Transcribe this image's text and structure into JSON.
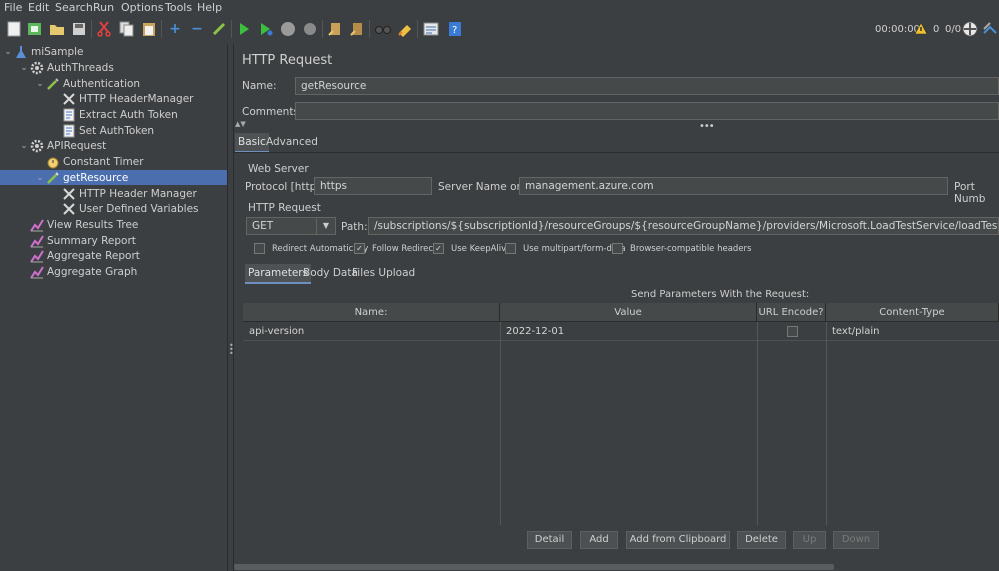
{
  "menu": [
    "File",
    "Edit",
    "Search",
    "Run",
    "Options",
    "Tools",
    "Help"
  ],
  "toolbar": {
    "icons": [
      "new-icon",
      "templates-icon",
      "open-icon",
      "save-icon",
      "cut-icon",
      "copy-icon",
      "paste-icon",
      "expand-icon",
      "collapse-icon",
      "toggle-icon",
      "start-icon",
      "start-no-pause-icon",
      "stop-icon",
      "shutdown-icon",
      "clear-icon",
      "clear-all-icon",
      "search-icon",
      "reset-search-icon",
      "function-helper-icon",
      "help-icon"
    ],
    "timer": "00:00:00",
    "warnings": "0",
    "threads": "0/0"
  },
  "tree": {
    "nodes": [
      {
        "label": "miSample",
        "icon": "test-plan-icon",
        "level": 0,
        "expanded": true
      },
      {
        "label": "AuthThreads",
        "icon": "thread-group-icon",
        "level": 1,
        "expanded": true
      },
      {
        "label": "Authentication",
        "icon": "sampler-icon",
        "level": 2,
        "expanded": true
      },
      {
        "label": "HTTP HeaderManager",
        "icon": "config-icon",
        "level": 3
      },
      {
        "label": "Extract Auth Token",
        "icon": "script-icon",
        "level": 3
      },
      {
        "label": "Set AuthToken",
        "icon": "script-icon",
        "level": 3
      },
      {
        "label": "APIRequest",
        "icon": "thread-group-icon",
        "level": 1,
        "expanded": true
      },
      {
        "label": "Constant Timer",
        "icon": "timer-icon",
        "level": 2
      },
      {
        "label": "getResource",
        "icon": "sampler-icon",
        "level": 2,
        "expanded": true,
        "selected": true
      },
      {
        "label": "HTTP Header Manager",
        "icon": "config-icon",
        "level": 3
      },
      {
        "label": "User Defined Variables",
        "icon": "config-icon",
        "level": 3
      },
      {
        "label": "View Results Tree",
        "icon": "listener-icon",
        "level": 1
      },
      {
        "label": "Summary Report",
        "icon": "listener-icon",
        "level": 1
      },
      {
        "label": "Aggregate Report",
        "icon": "listener-icon",
        "level": 1
      },
      {
        "label": "Aggregate Graph",
        "icon": "listener-icon",
        "level": 1
      }
    ]
  },
  "panel": {
    "title": "HTTP Request",
    "name_label": "Name:",
    "name_value": "getResource",
    "comments_label": "Comments:",
    "comments_value": "",
    "tabs": [
      "Basic",
      "Advanced"
    ],
    "web_server_label": "Web Server",
    "protocol_label": "Protocol [http]:",
    "protocol_value": "https",
    "server_label": "Server Name or IP:",
    "server_value": "management.azure.com",
    "port_label": "Port Numb",
    "http_request_label": "HTTP Request",
    "method": "GET",
    "path_label": "Path:",
    "path_value": "/subscriptions/${subscriptionId}/resourceGroups/${resourceGroupName}/providers/Microsoft.LoadTestService/loadTests/${loadTestName}",
    "checkboxes": [
      {
        "label": "Redirect Automatically",
        "checked": false
      },
      {
        "label": "Follow Redirects",
        "checked": true
      },
      {
        "label": "Use KeepAlive",
        "checked": true
      },
      {
        "label": "Use multipart/form-data",
        "checked": false
      },
      {
        "label": "Browser-compatible headers",
        "checked": false
      }
    ],
    "subtabs": [
      "Parameters",
      "Body Data",
      "Files Upload"
    ],
    "send_title": "Send Parameters With the Request:",
    "columns": [
      "Name:",
      "Value",
      "URL Encode?",
      "Content-Type"
    ],
    "rows": [
      {
        "name": "api-version",
        "value": "2022-12-01",
        "encode": false,
        "content_type": "text/plain"
      }
    ],
    "buttons": [
      {
        "label": "Detail",
        "enabled": true
      },
      {
        "label": "Add",
        "enabled": true
      },
      {
        "label": "Add from Clipboard",
        "enabled": true
      },
      {
        "label": "Delete",
        "enabled": true
      },
      {
        "label": "Up",
        "enabled": false
      },
      {
        "label": "Down",
        "enabled": false
      }
    ]
  }
}
